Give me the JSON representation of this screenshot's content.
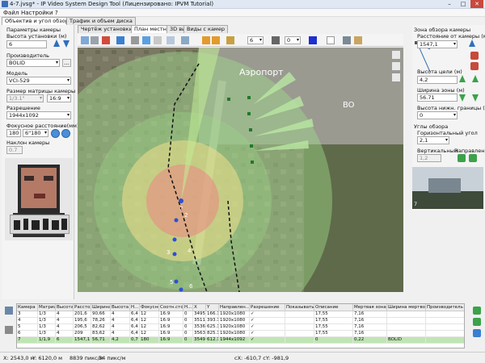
{
  "window": {
    "title": "4-7.jvsg* - IP Video System Design Tool (Лицензировано: IPVM Tutorial)",
    "controls": [
      "–",
      "□",
      "✕"
    ]
  },
  "menu": [
    "Файл",
    "Настройки",
    "?"
  ],
  "left_tabs": [
    "Объектив и угол обзора",
    "Трафик и объем диска"
  ],
  "left": {
    "section_title": "Параметры камеры",
    "height_label": "Высота установки (м)",
    "height_value": "6",
    "manufacturer_label": "Производитель",
    "manufacturer_value": "BOLID",
    "model_label": "Модель",
    "model_value": "VCI-529",
    "sensor_label": "Размер матрицы камеры",
    "sensor_value": "1/3.1\"",
    "sensor_value2": "16:9",
    "resolution_label": "Разрешение",
    "resolution_value": "1944x1092",
    "focal_label": "Фокусное расстояние(мм)",
    "focal_value": "180",
    "focal_value2": "6\"180",
    "tilt_label": "Наклон камеры",
    "tilt_value": "0.7"
  },
  "center_tabs": [
    "Чертёж установки камеры",
    "План местности",
    "3D вид",
    "Виды с камер"
  ],
  "toolbar": {
    "field1": "6",
    "field2": "0"
  },
  "map": {
    "label_airport": "Аэропорт",
    "label_bo": "BO",
    "marker_labels": [
      "7",
      "2",
      "3",
      "4",
      "5",
      "6"
    ]
  },
  "right": {
    "section_title": "Зона обзора камеры",
    "distance_label": "Расстояние от камеры (м)",
    "distance_value": "1547,1",
    "target_height_label": "Высота цели (м)",
    "target_height_value": "4,2",
    "zone_width_label": "Ширина зоны (м)",
    "zone_width_value": "56.71",
    "lower_bound_label": "Высота нижн. границы (м)",
    "lower_bound_value": "0",
    "angles_title": "Углы обзора",
    "horizontal_label": "Горизонтальный угол",
    "horizontal_value": "2,1",
    "vertical_label": "Вертикальный",
    "vertical_value": "1,2",
    "direction_label": "Направление",
    "preview_label": "7"
  },
  "grid": {
    "columns": [
      "Камера",
      "Матрица",
      "Высота у...",
      "Рассто...",
      "Ширина ...",
      "Высота ц...",
      "Н...",
      "Фокусное",
      "Соотн.сто...",
      "Н...",
      "X",
      "Y",
      "Направлен...",
      "Разрешение",
      "Показывать",
      "Описание",
      "Мертвая зона",
      "Ширина мертвой...",
      "Производитель"
    ],
    "rows": [
      [
        "3",
        "1/3",
        "4",
        "201,6",
        "90,66",
        "4",
        "6,4",
        "12",
        "16:9",
        "0",
        "3495.5",
        "166.172,9",
        "1920x1080",
        "✓",
        "",
        "17,55",
        "7,16",
        ""
      ],
      [
        "4",
        "1/3",
        "4",
        "195,6",
        "78,26",
        "4",
        "6,4",
        "12",
        "16:9",
        "0",
        "3511.4",
        "393.172,7",
        "1920x1080",
        "✓",
        "",
        "17,55",
        "7,16",
        ""
      ],
      [
        "5",
        "1/3",
        "4",
        "206,5",
        "82,62",
        "4",
        "6,4",
        "12",
        "16:9",
        "0",
        "3536.4",
        "625.172,7",
        "1920x1080",
        "✓",
        "",
        "17,55",
        "7,16",
        ""
      ],
      [
        "6",
        "1/3",
        "4",
        "209",
        "83,62",
        "4",
        "6,4",
        "12",
        "16:9",
        "0",
        "3563.4",
        "825.172,7",
        "1920x1080",
        "✓",
        "",
        "17,55",
        "7,16",
        ""
      ],
      [
        "7",
        "1/1,9",
        "6",
        "1547,1",
        "56,71",
        "4,2",
        "0,7",
        "180",
        "16:9",
        "0",
        "3549.5",
        "612.179,9",
        "1944x1092",
        "✓",
        "",
        "0",
        "0,22",
        "BOLID"
      ]
    ]
  },
  "status": {
    "x": "X: 2543,0 м",
    "y": "Y: 6120,0 м",
    "ppm1": "8839 пикс/м",
    "ppm2": "34 пикс/м",
    "cxy": "сX: -610,7  сY: -981,9"
  },
  "colors": {
    "zone_green": "#9fd98a",
    "zone_yellow": "#f1e08a",
    "zone_red": "#e88c82",
    "selected_row": "#bfe5b3",
    "arrow_blue": "#2f6fbf",
    "arrow_green": "#3ba24a"
  }
}
